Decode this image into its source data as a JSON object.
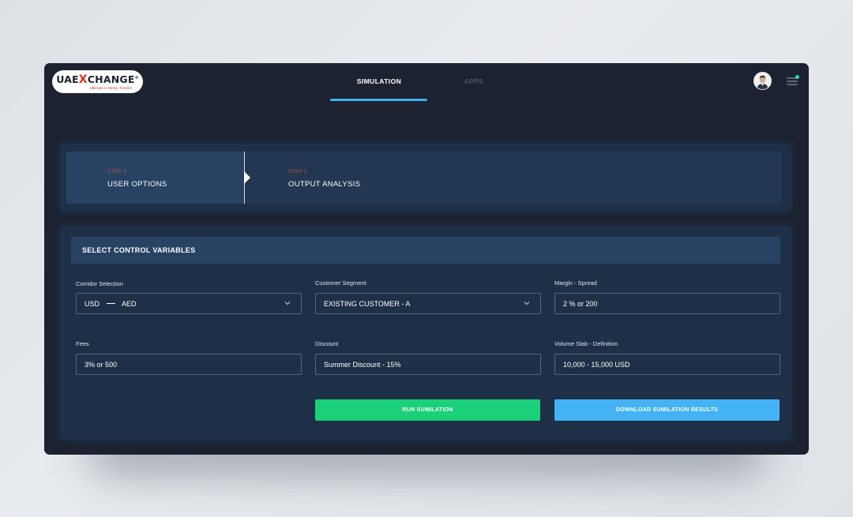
{
  "brand": {
    "logo_main_1": "UAE",
    "logo_x": "X",
    "logo_main_2": "CHANGE",
    "logo_reg": "®",
    "logo_tagline": "Ultimate in Money Transfer"
  },
  "nav": {
    "tabs": [
      {
        "label": "SIMULATION",
        "active": true
      },
      {
        "label": "APPS",
        "active": false
      }
    ],
    "accent_color": "#3fb0f1"
  },
  "header_icons": [
    "avatar",
    "menu-icon",
    "notification-dot"
  ],
  "steps": [
    {
      "number": "STEP 1",
      "title": "USER OPTIONS",
      "active": true
    },
    {
      "number": "STEP 2",
      "title": "OUTPUT ANALYSIS",
      "active": false
    }
  ],
  "form": {
    "title": "SELECT CONTROL VARIABLES",
    "corridor": {
      "label": "Corridor Selection",
      "from": "USD",
      "to": "AED"
    },
    "segment": {
      "label": "Customer Segment",
      "value": "EXISTING CUSTOMER - A"
    },
    "margin": {
      "label": "Margin - Spread",
      "value": "2 % or 200"
    },
    "fees": {
      "label": "Fees",
      "value": "3% or 500"
    },
    "discount": {
      "label": "Discount",
      "value": "Summer Discount - 15%"
    },
    "volume": {
      "label": "Volume Slab - Definition",
      "value": "10,000 - 15,000 USD"
    }
  },
  "buttons": {
    "run": "RUN SUMILATION",
    "download": "DOWNLOAD SUMILATION RESULTS",
    "run_color": "#1ad079",
    "download_color": "#43b3f5"
  }
}
